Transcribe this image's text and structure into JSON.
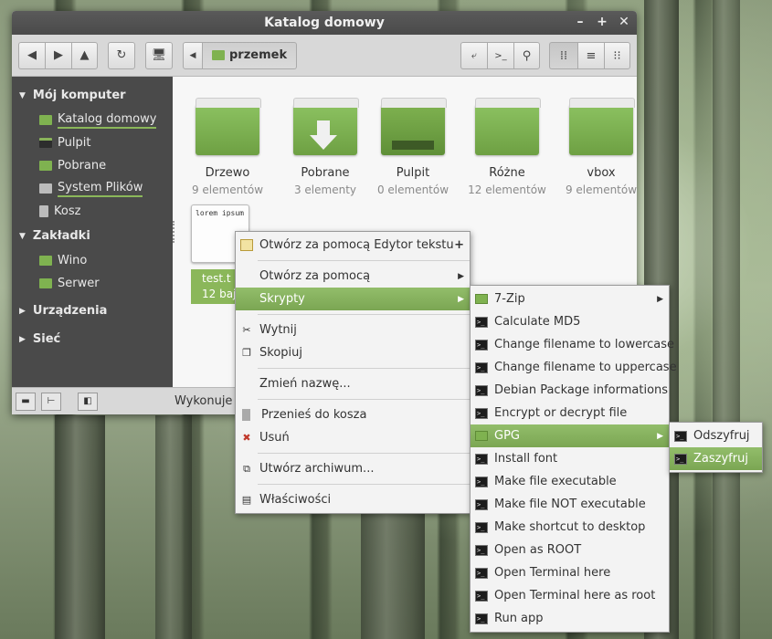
{
  "window": {
    "title": "Katalog domowy"
  },
  "toolbar": {
    "location": "przemek"
  },
  "sidebar": {
    "sections": [
      {
        "label": "Mój komputer",
        "items": [
          "Katalog domowy",
          "Pulpit",
          "Pobrane",
          "System Plików",
          "Kosz"
        ]
      },
      {
        "label": "Zakładki",
        "items": [
          "Wino",
          "Serwer"
        ]
      },
      {
        "label": "Urządzenia",
        "items": []
      },
      {
        "label": "Sieć",
        "items": []
      }
    ]
  },
  "folders": [
    {
      "name": "Drzewo",
      "count": "9 elementów"
    },
    {
      "name": "Pobrane",
      "count": "3 elementy"
    },
    {
      "name": "Pulpit",
      "count": "0 elementów"
    },
    {
      "name": "Różne",
      "count": "12 elementów"
    },
    {
      "name": "vbox",
      "count": "9 elementów"
    }
  ],
  "file": {
    "name": "test.t",
    "size": "12 bajt",
    "preview": "lorem ipsum"
  },
  "status": {
    "text": "Wykonuje sk"
  },
  "context_menu": {
    "open_with_editor": "Otwórz za pomocą Edytor tekstu",
    "open_with": "Otwórz za pomocą",
    "scripts": "Skrypty",
    "cut": "Wytnij",
    "copy": "Skopiuj",
    "rename": "Zmień nazwę...",
    "trash": "Przenieś do kosza",
    "delete": "Usuń",
    "archive": "Utwórz archiwum...",
    "properties": "Właściwości"
  },
  "scripts_menu": {
    "items": [
      "7-Zip",
      "Calculate MD5",
      "Change filename to lowercase",
      "Change filename to uppercase",
      "Debian Package informations",
      "Encrypt or decrypt file",
      "GPG",
      "Install font",
      "Make file executable",
      "Make file NOT executable",
      "Make shortcut to desktop",
      "Open as ROOT",
      "Open Terminal here",
      "Open Terminal here as root",
      "Run app"
    ]
  },
  "gpg_menu": {
    "items": [
      "Odszyfruj",
      "Zaszyfruj"
    ]
  },
  "colors": {
    "accent": "#7ba653",
    "sidebar": "#4a4a4a"
  }
}
